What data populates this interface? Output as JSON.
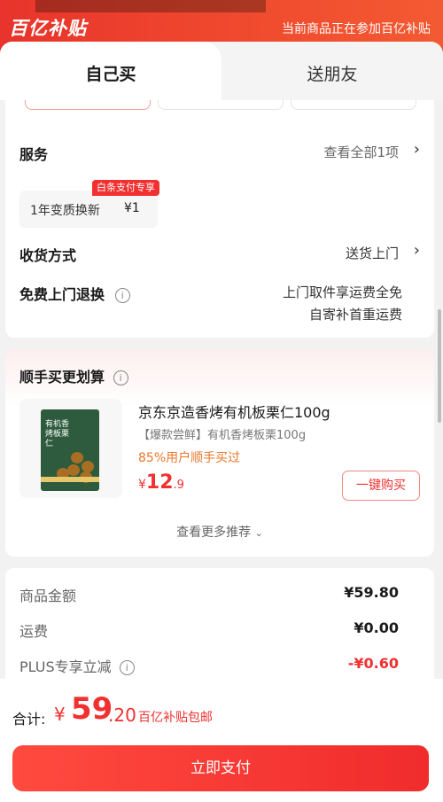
{
  "banner": {
    "logo": "百亿补贴",
    "notice": "当前商品正在参加百亿补贴"
  },
  "tabs": {
    "self": "自己买",
    "gift": "送朋友"
  },
  "service": {
    "label": "服务",
    "view_all": "查看全部1项",
    "chip": {
      "tag": "白条支付专享",
      "name": "1年变质换新",
      "price": "¥1"
    }
  },
  "delivery": {
    "label": "收货方式",
    "value": "送货上门"
  },
  "return_service": {
    "label": "免费上门退换",
    "line1": "上门取件享运费全免",
    "line2": "自寄补首重运费"
  },
  "addon": {
    "title": "顺手买更划算",
    "product": {
      "title": "京东京造香烤有机板栗仁100g",
      "subtitle": "【爆款尝鲜】有机香烤板栗100g",
      "buyers": "85%用户顺手买过",
      "price_symbol": "¥",
      "price_int": "12",
      "price_dec": ".9",
      "buy_button": "一键购买",
      "pack_text": "有机香烤板栗仁"
    },
    "see_more": "查看更多推荐"
  },
  "summary": {
    "items": [
      {
        "label": "商品金额",
        "value": "¥59.80"
      },
      {
        "label": "运费",
        "value": "¥0.00"
      },
      {
        "label": "PLUS专享立减",
        "value": "-¥0.60"
      }
    ]
  },
  "footer": {
    "total_label": "合计:",
    "symbol": "¥",
    "amount_int": "59",
    "amount_dec": ".20",
    "note": "百亿补贴包邮",
    "pay_button": "立即支付"
  },
  "colors": {
    "accent": "#f23030",
    "banner": "#e8342c",
    "buyers": "#e8772a"
  }
}
